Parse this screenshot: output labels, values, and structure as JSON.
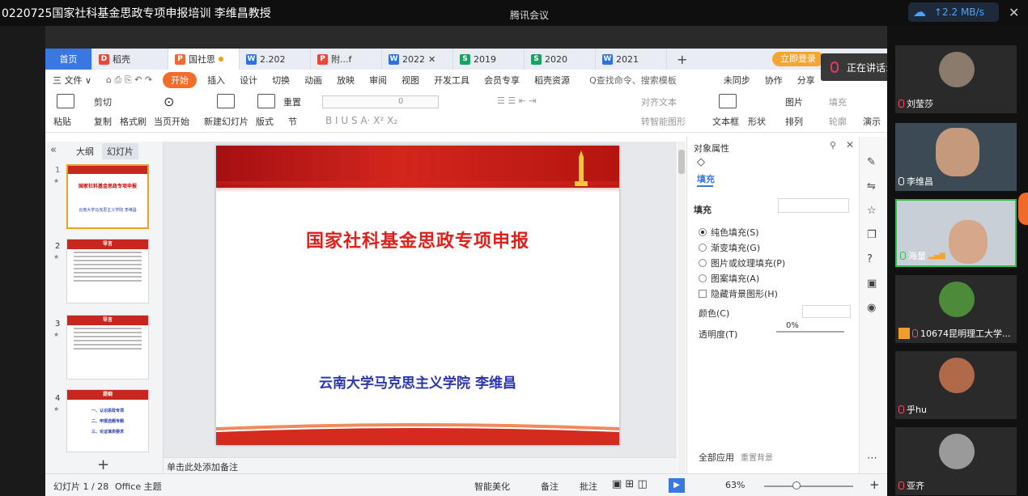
{
  "window": {
    "title": "0220725国家社科基金思政专项申报培训 李维昌教授",
    "app_title": "腾讯会议",
    "upload_rate": "↑2.2 MB/s",
    "close": "✕"
  },
  "tabs": [
    {
      "label": "首页",
      "kind": "home"
    },
    {
      "label": "稻壳",
      "icon": "D",
      "color": "red"
    },
    {
      "label": "国社思",
      "icon": "P",
      "color": "orange",
      "active": true
    },
    {
      "label": "2.202",
      "icon": "W",
      "color": "blue"
    },
    {
      "label": "附...f",
      "icon": "P",
      "color": "red"
    },
    {
      "label": "2022",
      "icon": "W",
      "color": "blue"
    },
    {
      "label": "2019",
      "icon": "S",
      "color": "green"
    },
    {
      "label": "2020",
      "icon": "S",
      "color": "green"
    },
    {
      "label": "2021",
      "icon": "W",
      "color": "blue"
    }
  ],
  "login_label": "立即登录",
  "speaking": "正在讲话: 海量;",
  "menu": {
    "file": "三 文件 ∨",
    "items": [
      "插入",
      "设计",
      "切换",
      "动画",
      "放映",
      "审阅",
      "视图",
      "开发工具",
      "会员专享",
      "稻壳资源"
    ],
    "start": "开始",
    "search": "Q查找命令、搜索模板",
    "sync": "未同步",
    "collab": "协作",
    "share": "分享"
  },
  "ribbon": {
    "paste": "粘贴",
    "cut": "剪切",
    "copy": "复制",
    "format": "格式刷",
    "play_from": "当页开始",
    "new_slide": "新建幻灯片",
    "layout": "版式",
    "section": "节",
    "reset": "重置",
    "font_size": "0",
    "align_text": "对齐文本",
    "convert": "转智能图形",
    "textbox": "文本框",
    "shape": "形状",
    "arrange": "排列",
    "image": "图片",
    "fill": "填充",
    "outline": "轮廓",
    "present": "演示"
  },
  "thumbs": {
    "tab_outline": "大纲",
    "tab_slides": "幻灯片",
    "slides": [
      {
        "num": "1",
        "title": "国家社科基金思政专项申报",
        "sub": "云南大学马克思主义学院    李维昌"
      },
      {
        "num": "2",
        "title": "导言"
      },
      {
        "num": "3",
        "title": "导言"
      },
      {
        "num": "4",
        "title": "提纲",
        "items": [
          "一、认识思政专项",
          "二、申报选题专题",
          "三、论证填表要求"
        ]
      }
    ]
  },
  "slide": {
    "title": "国家社科基金思政专项申报",
    "subtitle": "云南大学马克思主义学院    李维昌"
  },
  "notes": "单击此处添加备注",
  "props": {
    "header": "对象属性",
    "tab_fill": "填充",
    "section_fill": "填充",
    "options": [
      "纯色填充(S)",
      "渐变填充(G)",
      "图片或纹理填充(P)",
      "图案填充(A)"
    ],
    "checkbox": "隐藏背景图形(H)",
    "color_label": "颜色(C)",
    "transparency_label": "透明度(T)",
    "transparency_value": "0%",
    "apply_all": "全部应用",
    "reset_bg": "重置背景"
  },
  "status": {
    "slide_count": "幻灯片 1 / 28",
    "theme": "Office 主题",
    "beautify": "智能美化",
    "notes": "备注",
    "comment": "批注",
    "zoom": "63%"
  },
  "participants": [
    {
      "name": "刘莹莎",
      "mic": "muted"
    },
    {
      "name": "李维昌",
      "mic": "on"
    },
    {
      "name": "海量",
      "mic": "on",
      "active": true
    },
    {
      "name": "10674昆明理工大学...",
      "mic": "muted"
    },
    {
      "name": "乎hu",
      "mic": "muted"
    },
    {
      "name": "亚齐",
      "mic": "muted"
    }
  ],
  "colors": {
    "accent": "#3a77e0",
    "start_btn": "#f26d2a",
    "slide_red": "#e0201a",
    "slide_blue": "#2b37b0"
  }
}
